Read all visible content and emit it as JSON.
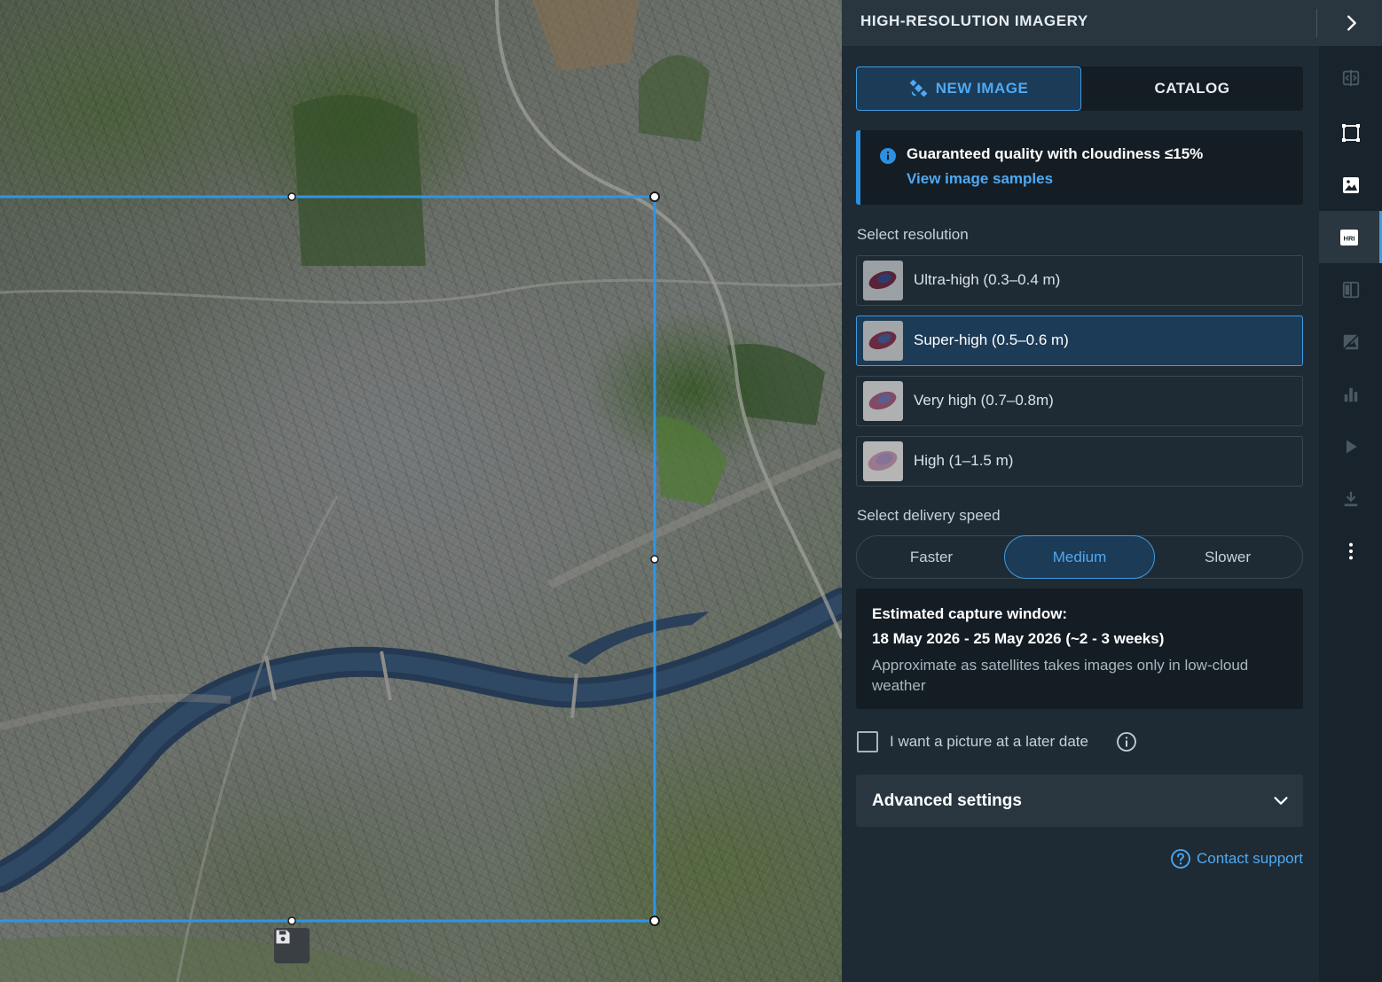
{
  "panel": {
    "title": "HIGH-RESOLUTION IMAGERY",
    "tabs": {
      "new_image": "NEW IMAGE",
      "catalog": "CATALOG"
    },
    "info": {
      "title": "Guaranteed quality with cloudiness ≤15%",
      "link": "View image samples"
    },
    "resolution": {
      "label": "Select resolution",
      "options": [
        {
          "label": "Ultra-high (0.3–0.4 m)",
          "selected": false
        },
        {
          "label": "Super-high (0.5–0.6 m)",
          "selected": true
        },
        {
          "label": "Very high (0.7–0.8m)",
          "selected": false
        },
        {
          "label": "High (1–1.5 m)",
          "selected": false
        }
      ]
    },
    "delivery": {
      "label": "Select delivery speed",
      "options": [
        "Faster",
        "Medium",
        "Slower"
      ],
      "selected": "Medium"
    },
    "estimate": {
      "title": "Estimated capture window:",
      "dates": "18 May 2026 - 25 May 2026 (~2 - 3 weeks)",
      "note": "Approximate as satellites takes images only in low-cloud weather"
    },
    "later_date": {
      "label": "I want a picture at a later date",
      "checked": false
    },
    "advanced": {
      "label": "Advanced settings"
    },
    "support": {
      "label": "Contact support"
    }
  },
  "toolbar": {
    "items": [
      "compare-icon",
      "polygon-icon",
      "image-icon",
      "hri-icon",
      "split-icon",
      "no-image-icon",
      "bar-chart-icon",
      "play-icon",
      "download-icon",
      "more-icon"
    ],
    "active": "hri-icon",
    "hri_badge": "HRI"
  },
  "colors": {
    "accent": "#3d9be0",
    "panel_bg": "#1f2b34",
    "selection": "#1c3b57"
  }
}
